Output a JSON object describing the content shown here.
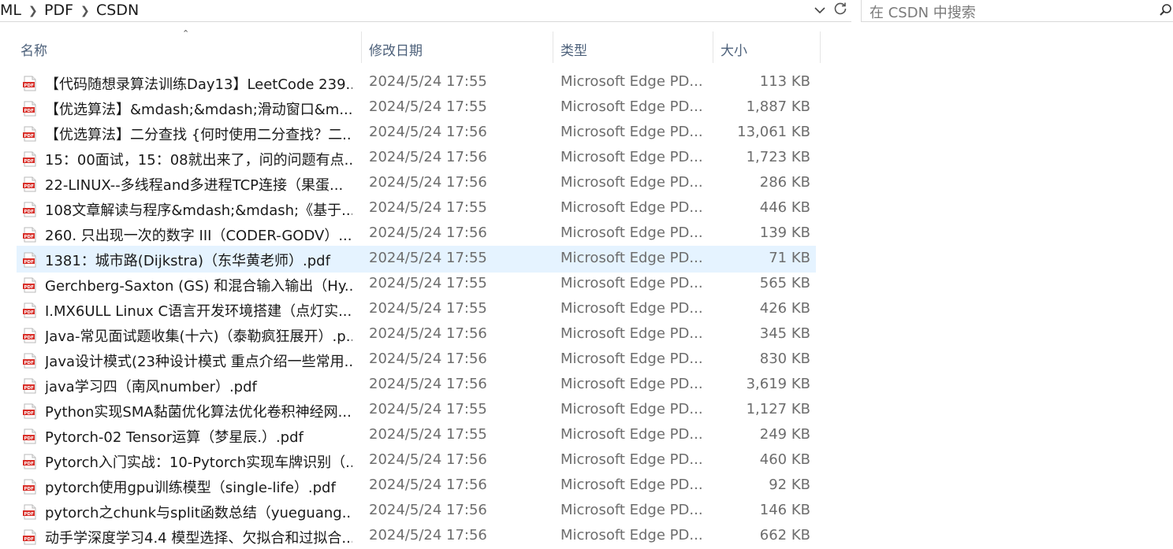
{
  "breadcrumb": {
    "items": [
      "ML",
      "PDF",
      "CSDN"
    ]
  },
  "search": {
    "placeholder": "在 CSDN 中搜索"
  },
  "columns": {
    "name": "名称",
    "date": "修改日期",
    "type": "类型",
    "size": "大小"
  },
  "icons": {
    "file": "pdf-file-icon",
    "search": "search-icon",
    "refresh": "refresh-icon",
    "dropdown": "chevron-down-icon"
  },
  "colors": {
    "pdf_red": "#d9302a",
    "selection": "#e5f3ff",
    "header_text": "#4c607a"
  },
  "files": [
    {
      "name": "【代码随想录算法训练Day13】LeetCode 239....",
      "date": "2024/5/24 17:55",
      "type": "Microsoft Edge PD...",
      "size": "113 KB"
    },
    {
      "name": "【优选算法】&mdash;&mdash;滑动窗口&m...",
      "date": "2024/5/24 17:55",
      "type": "Microsoft Edge PD...",
      "size": "1,887 KB"
    },
    {
      "name": "【优选算法】二分查找 {何时使用二分查找？二...",
      "date": "2024/5/24 17:56",
      "type": "Microsoft Edge PD...",
      "size": "13,061 KB"
    },
    {
      "name": "15：00面试，15：08就出来了，问的问题有点...",
      "date": "2024/5/24 17:56",
      "type": "Microsoft Edge PD...",
      "size": "1,723 KB"
    },
    {
      "name": "22-LINUX--多线程and多进程TCP连接（果蛋...",
      "date": "2024/5/24 17:56",
      "type": "Microsoft Edge PD...",
      "size": "286 KB"
    },
    {
      "name": "108文章解读与程序&mdash;&mdash;《基于...",
      "date": "2024/5/24 17:55",
      "type": "Microsoft Edge PD...",
      "size": "446 KB"
    },
    {
      "name": "260. 只出现一次的数字 III（CODER-GODV）....",
      "date": "2024/5/24 17:56",
      "type": "Microsoft Edge PD...",
      "size": "139 KB"
    },
    {
      "name": "1381：城市路(Dijkstra)（东华黄老师）.pdf",
      "date": "2024/5/24 17:55",
      "type": "Microsoft Edge PD...",
      "size": "71 KB"
    },
    {
      "name": "Gerchberg-Saxton (GS) 和混合输入输出（Hy...",
      "date": "2024/5/24 17:55",
      "type": "Microsoft Edge PD...",
      "size": "565 KB"
    },
    {
      "name": "I.MX6ULL Linux C语言开发环境搭建（点灯实...",
      "date": "2024/5/24 17:55",
      "type": "Microsoft Edge PD...",
      "size": "426 KB"
    },
    {
      "name": "Java-常见面试题收集(十六)（泰勒疯狂展开）.p...",
      "date": "2024/5/24 17:56",
      "type": "Microsoft Edge PD...",
      "size": "345 KB"
    },
    {
      "name": "Java设计模式(23种设计模式 重点介绍一些常用...",
      "date": "2024/5/24 17:56",
      "type": "Microsoft Edge PD...",
      "size": "830 KB"
    },
    {
      "name": "java学习四（南风number）.pdf",
      "date": "2024/5/24 17:56",
      "type": "Microsoft Edge PD...",
      "size": "3,619 KB"
    },
    {
      "name": "Python实现SMA黏菌优化算法优化卷积神经网...",
      "date": "2024/5/24 17:55",
      "type": "Microsoft Edge PD...",
      "size": "1,127 KB"
    },
    {
      "name": "Pytorch-02 Tensor运算（梦星辰.）.pdf",
      "date": "2024/5/24 17:55",
      "type": "Microsoft Edge PD...",
      "size": "249 KB"
    },
    {
      "name": "Pytorch入门实战：10-Pytorch实现车牌识别（...",
      "date": "2024/5/24 17:56",
      "type": "Microsoft Edge PD...",
      "size": "460 KB"
    },
    {
      "name": "pytorch使用gpu训练模型（single-life）.pdf",
      "date": "2024/5/24 17:56",
      "type": "Microsoft Edge PD...",
      "size": "92 KB"
    },
    {
      "name": "pytorch之chunk与split函数总结（yueguang...",
      "date": "2024/5/24 17:56",
      "type": "Microsoft Edge PD...",
      "size": "146 KB"
    },
    {
      "name": "动手学深度学习4.4 模型选择、欠拟合和过拟合...",
      "date": "2024/5/24 17:56",
      "type": "Microsoft Edge PD...",
      "size": "662 KB"
    }
  ]
}
